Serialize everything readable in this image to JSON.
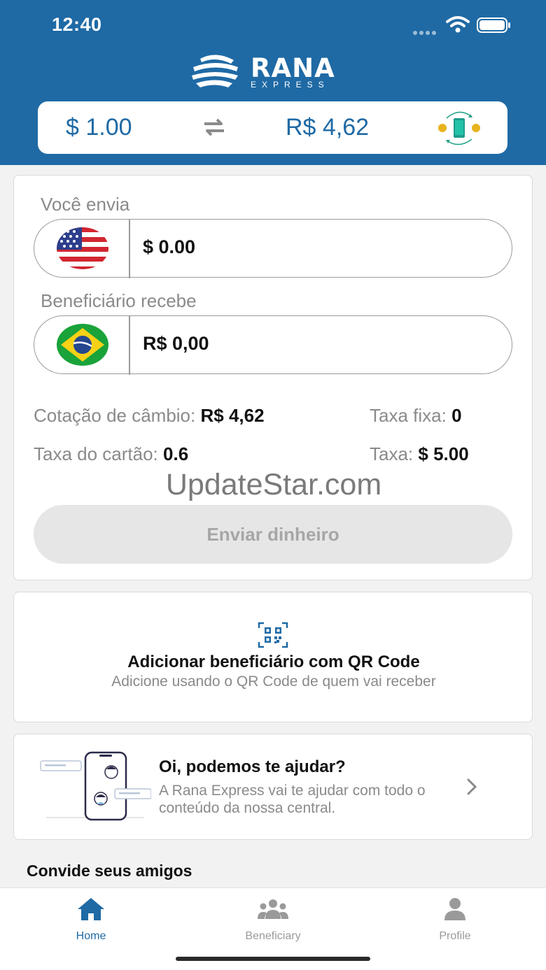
{
  "status": {
    "time": "12:40"
  },
  "header": {
    "brand": "RANA",
    "brand_sub": "EXPRESS",
    "rate_from": "$ 1.00",
    "rate_to": "R$ 4,62"
  },
  "calculator": {
    "send_label": "Você envia",
    "send_value": "$ 0.00",
    "receive_label": "Beneficiário recebe",
    "receive_value": "R$ 0,00",
    "exchange_rate_label": "Cotação de câmbio:",
    "exchange_rate_value": "R$ 4,62",
    "fixed_fee_label": "Taxa fixa:",
    "fixed_fee_value": "0",
    "card_fee_label": "Taxa do cartão:",
    "card_fee_value": "0.6",
    "fee_label": "Taxa:",
    "fee_value": "$ 5.00",
    "send_button": "Enviar dinheiro"
  },
  "watermark": "UpdateStar.com",
  "qr_card": {
    "title": "Adicionar beneficiário com QR Code",
    "subtitle": "Adicione usando o QR Code de quem vai receber"
  },
  "help_card": {
    "title": "Oi, podemos te ajudar?",
    "text": "A Rana Express vai te ajudar com todo o conteúdo da nossa central."
  },
  "invite_title": "Convide seus amigos",
  "tabs": [
    {
      "label": "Home",
      "icon": "home-icon",
      "active": true
    },
    {
      "label": "Beneficiary",
      "icon": "people-icon",
      "active": false
    },
    {
      "label": "Profile",
      "icon": "person-icon",
      "active": false
    }
  ],
  "colors": {
    "primary": "#1f6aa5",
    "muted": "#8a8a8a",
    "disabled_button": "#e6e6e6"
  }
}
